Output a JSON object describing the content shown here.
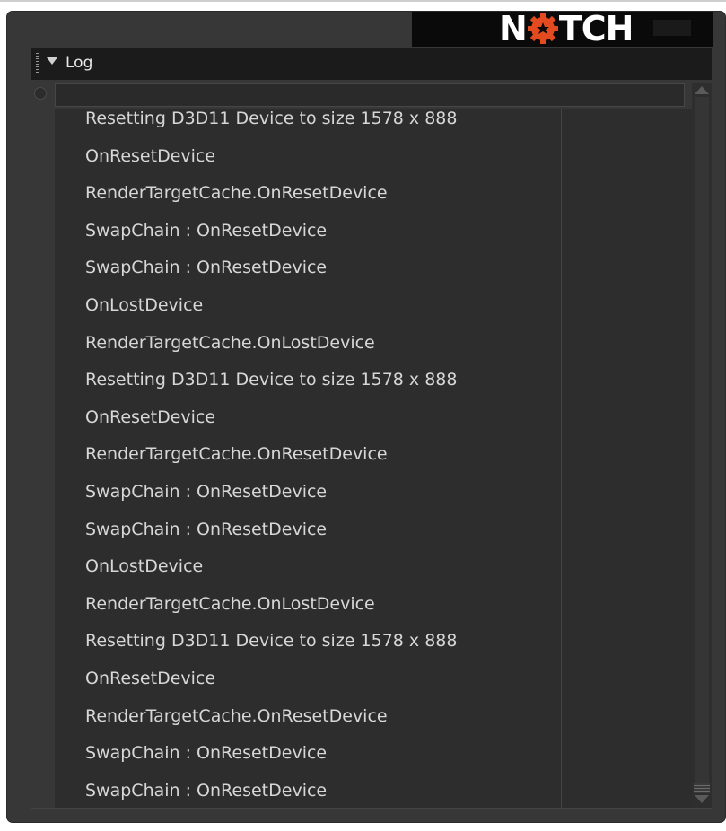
{
  "brand": {
    "logo_text_left": "N",
    "logo_text_right": "TCH",
    "logo_color": "#ffffff",
    "gear_color": "#e34a1f"
  },
  "panel": {
    "title": "Log"
  },
  "filter": {
    "value": "",
    "placeholder": ""
  },
  "log": {
    "entries": [
      "Resetting D3D11 Device to size 1578 x 888",
      "OnResetDevice",
      "RenderTargetCache.OnResetDevice",
      "SwapChain : OnResetDevice",
      "SwapChain : OnResetDevice",
      "OnLostDevice",
      "RenderTargetCache.OnLostDevice",
      "Resetting D3D11 Device to size 1578 x 888",
      "OnResetDevice",
      "RenderTargetCache.OnResetDevice",
      "SwapChain : OnResetDevice",
      "SwapChain : OnResetDevice",
      "OnLostDevice",
      "RenderTargetCache.OnLostDevice",
      "Resetting D3D11 Device to size 1578 x 888",
      "OnResetDevice",
      "RenderTargetCache.OnResetDevice",
      "SwapChain : OnResetDevice",
      "SwapChain : OnResetDevice"
    ]
  },
  "colors": {
    "panel_bg": "#373737",
    "header_bg": "#1b1b1b",
    "text": "#d7d7d7"
  },
  "scroll": {
    "position": 1.0
  }
}
